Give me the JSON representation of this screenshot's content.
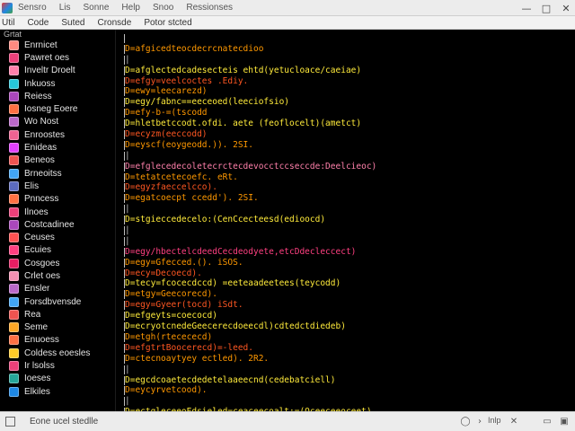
{
  "window": {
    "menu": [
      "Sensro",
      "Lis",
      "Sonne",
      "Help",
      "Snoo",
      "Ressionses"
    ],
    "controls": {
      "minimize": "—",
      "maximize": "□",
      "close": "✕"
    }
  },
  "toolbar": {
    "items": [
      "Util",
      "Code",
      "Suted",
      "Cronsde",
      "Potor stcted"
    ]
  },
  "sidebar": {
    "header": "Grtat",
    "items": [
      {
        "label": "Enrnicet",
        "icon": "file-icon",
        "color": "#ff8a80"
      },
      {
        "label": "Pawret oes",
        "icon": "folder-icon",
        "color": "#ec407a"
      },
      {
        "label": "Inveltr Droelt",
        "icon": "file-icon",
        "color": "#ff80ab"
      },
      {
        "label": "Inkuoss",
        "icon": "file-icon",
        "color": "#26c6da"
      },
      {
        "label": "Reiess",
        "icon": "file-icon",
        "color": "#ab47bc"
      },
      {
        "label": "Iosneg Eoere",
        "icon": "file-icon",
        "color": "#ff7043"
      },
      {
        "label": "Wo Nost",
        "icon": "file-icon",
        "color": "#ba68c8"
      },
      {
        "label": "Enroostes",
        "icon": "file-icon",
        "color": "#f06292"
      },
      {
        "label": "Enideas",
        "icon": "file-icon",
        "color": "#e040fb"
      },
      {
        "label": "Beneos",
        "icon": "file-icon",
        "color": "#ef5350"
      },
      {
        "label": "Brneoitss",
        "icon": "file-icon",
        "color": "#42a5f5"
      },
      {
        "label": "Elis",
        "icon": "file-icon",
        "color": "#5c6bc0"
      },
      {
        "label": "Pnncess",
        "icon": "file-icon",
        "color": "#ff7043"
      },
      {
        "label": "Ilnoes",
        "icon": "file-icon",
        "color": "#ec407a"
      },
      {
        "label": "Costcadinee",
        "icon": "file-icon",
        "color": "#ab47bc"
      },
      {
        "label": "Ceuses",
        "icon": "file-icon",
        "color": "#ff5252"
      },
      {
        "label": "Ecuies",
        "icon": "file-icon",
        "color": "#ff4081"
      },
      {
        "label": "Cosgoes",
        "icon": "file-icon",
        "color": "#e91e63"
      },
      {
        "label": "Crlet oes",
        "icon": "file-icon",
        "color": "#f48fb1"
      },
      {
        "label": "Ensler",
        "icon": "file-icon",
        "color": "#ba68c8"
      },
      {
        "label": "Forsdbvensde",
        "icon": "file-icon",
        "color": "#42a5f5"
      },
      {
        "label": "Rea",
        "icon": "file-icon",
        "color": "#ef5350"
      },
      {
        "label": "Seme",
        "icon": "file-icon",
        "color": "#ffa726"
      },
      {
        "label": "Enuoess",
        "icon": "file-icon",
        "color": "#ff7043"
      },
      {
        "label": "Coldess eoesles",
        "icon": "file-icon",
        "color": "#ffca28"
      },
      {
        "label": "Ir lsolss",
        "icon": "file-icon",
        "color": "#ec407a"
      },
      {
        "label": "Ioeses",
        "icon": "file-icon",
        "color": "#26a69a"
      },
      {
        "label": "Elkiles",
        "icon": "file-icon",
        "color": "#1e88e5"
      }
    ]
  },
  "editor": {
    "lines": [
      {
        "text": ""
      },
      {
        "text": "D=afgicedteocdecrcnatecdioo",
        "color": "#ff9800"
      },
      {
        "text": "|",
        "color": "#bdbdbd"
      },
      {
        "text": "D=afglectedcadesecteis ehtd(yetucloace/caeiae)",
        "color": "#ffeb3b"
      },
      {
        "text": "D=efgy=veelcoctes .Ediy.",
        "color": "#ff5722"
      },
      {
        "text": "D=ewy=leecarezd)",
        "color": "#ff9800"
      },
      {
        "text": "D=egy/fabnc==eeceoed(leeciofsio)",
        "color": "#ffeb3b"
      },
      {
        "text": "D=efy-b-=(tscodd",
        "color": "#ff9800"
      },
      {
        "text": "D=hletbetccodt.ofdi. aete (feoflocelt)(ametct)",
        "color": "#ffeb3b"
      },
      {
        "text": "D=ecyzm(eeccodd)",
        "color": "#ff5722"
      },
      {
        "text": "D=eyscf(eoygeodd.)). 2SI.",
        "color": "#ff9800"
      },
      {
        "text": "|",
        "color": "#bdbdbd"
      },
      {
        "text": "D=efglecedecoletecrctecdevocctccseccde:Deelcieoc)",
        "color": "#ff80ab"
      },
      {
        "text": "D=tetatcetecoefc. eRt.",
        "color": "#ff9800"
      },
      {
        "text": "D=egyzfaeccelcco).",
        "color": "#ff5722"
      },
      {
        "text": "D=egatcoecpt ccedd'). 2SI.",
        "color": "#ff9800"
      },
      {
        "text": "|",
        "color": "#bdbdbd"
      },
      {
        "text": "D=stgieccedecelo:(CenCcecteesd(edioocd)",
        "color": "#ffeb3b"
      },
      {
        "text": "|",
        "color": "#bdbdbd"
      },
      {
        "text": "|",
        "color": "#bdbdbd"
      },
      {
        "text": "D=egy/hbectelcdeedCecdeodyete,etcDdecleccect)",
        "color": "#ff4081"
      },
      {
        "text": "D=egy=Gfecced.(). iSOS.",
        "color": "#ff9800"
      },
      {
        "text": "D=ecy=Decoecd).",
        "color": "#ff5722"
      },
      {
        "text": "D=tecy=fcocecdccd) =eeteaadeetees(teycodd)",
        "color": "#ffeb3b"
      },
      {
        "text": "D=etgy=Geecorecd).",
        "color": "#ff9800"
      },
      {
        "text": "D=egy=Gyeer(tocd) iSdt.",
        "color": "#ff5722"
      },
      {
        "text": "D=efgeyts=coecocd)",
        "color": "#ffeb3b"
      },
      {
        "text": "D=ecryotcnedeGeecerecdoeecdl)cdtedctdiedeb)",
        "color": "#ffeb3b"
      },
      {
        "text": "D=etgh(rtecececd)",
        "color": "#ff9800"
      },
      {
        "text": "D=efgtrtBoocerecd)=-leed.",
        "color": "#ff5722"
      },
      {
        "text": "D=ctecnoaytyey ectled). 2R2.",
        "color": "#ff9800"
      },
      {
        "text": "|",
        "color": "#bdbdbd"
      },
      {
        "text": "D=egcdcoaetecdedetelaaeecnd(cedebatciell)",
        "color": "#ffeb3b"
      },
      {
        "text": "D=eycyrvetcood).",
        "color": "#ff9800"
      },
      {
        "text": "|",
        "color": "#bdbdbd"
      },
      {
        "text": "D=ectgleceeoEdsieled=ceaceecoalt;=(Oceeceeoceet)",
        "color": "#ffeb3b"
      }
    ]
  },
  "status": {
    "text": "Eone ucel stedlle",
    "right": "Inlp",
    "icons": [
      "circle-icon",
      "chevron-icon",
      "close-icon",
      "panel-icon",
      "window-icon"
    ]
  }
}
